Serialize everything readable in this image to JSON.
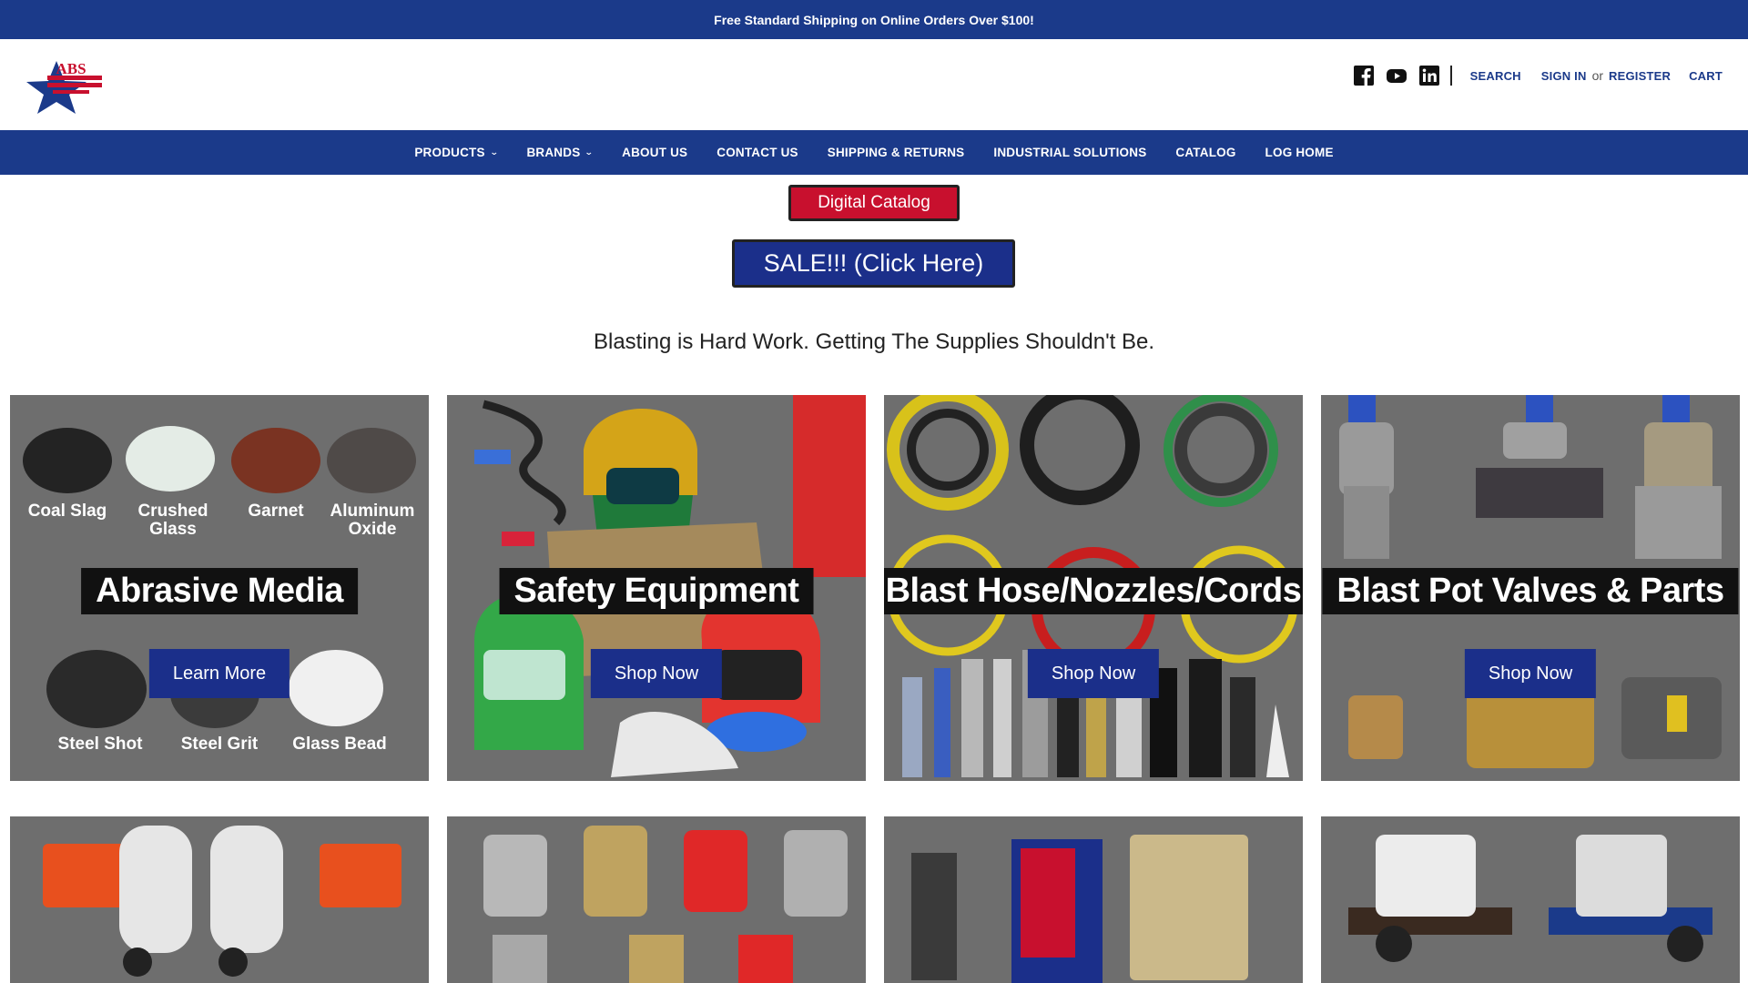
{
  "promo": {
    "text": "Free Standard Shipping on Online Orders Over $100!"
  },
  "header": {
    "logo_text": "ABS",
    "search_label": "SEARCH",
    "sign_in_label": "SIGN IN",
    "or_text": "or",
    "register_label": "REGISTER",
    "cart_label": "CART",
    "social": [
      "facebook-icon",
      "youtube-icon",
      "linkedin-icon"
    ]
  },
  "nav": {
    "items": [
      {
        "label": "PRODUCTS",
        "dropdown": true
      },
      {
        "label": "BRANDS",
        "dropdown": true
      },
      {
        "label": "ABOUT US",
        "dropdown": false
      },
      {
        "label": "CONTACT US",
        "dropdown": false
      },
      {
        "label": "SHIPPING & RETURNS",
        "dropdown": false
      },
      {
        "label": "INDUSTRIAL SOLUTIONS",
        "dropdown": false
      },
      {
        "label": "CATALOG",
        "dropdown": false
      },
      {
        "label": "LOG HOME",
        "dropdown": false
      }
    ]
  },
  "buttons": {
    "digital_catalog": "Digital Catalog",
    "sale": "SALE!!! (Click Here)"
  },
  "tagline": "Blasting is Hard Work. Getting The Supplies Shouldn't Be.",
  "tiles": [
    {
      "title": "Abrasive Media",
      "button": "Learn More",
      "media": [
        "Coal Slag",
        "Crushed Glass",
        "Garnet",
        "Aluminum Oxide",
        "Steel Shot",
        "Steel Grit",
        "Glass Bead"
      ]
    },
    {
      "title": "Safety Equipment",
      "button": "Shop Now"
    },
    {
      "title": "Blast Hose/Nozzles/Cords",
      "button": "Shop Now"
    },
    {
      "title": "Blast Pot Valves & Parts",
      "button": "Shop Now"
    }
  ],
  "colors": {
    "brand_blue": "#1b3a8a",
    "button_blue": "#1b2f8a",
    "catalog_red": "#c8102e",
    "tile_gray": "#6e6e6e"
  }
}
